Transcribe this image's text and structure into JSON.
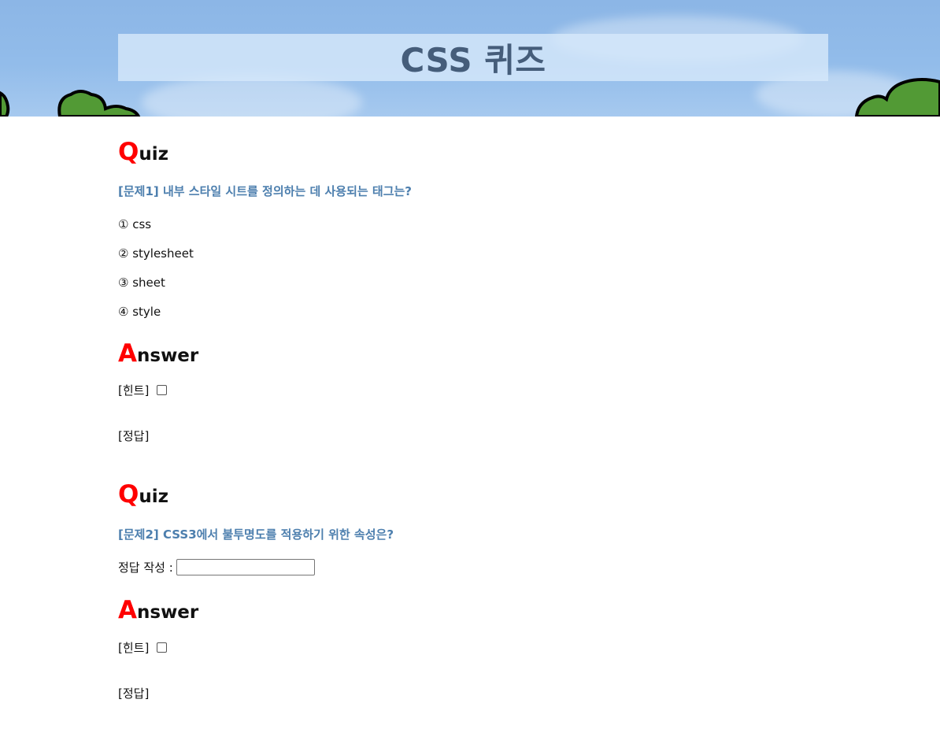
{
  "header": {
    "title": "CSS 퀴즈"
  },
  "quiz1": {
    "heading_cap": "Q",
    "heading_rest": "uiz",
    "question": "[문제1] 내부 스타일 시트를 정의하는 데 사용되는 태그는?",
    "options": [
      "① css",
      "② stylesheet",
      "③ sheet",
      "④ style"
    ],
    "answer_cap": "A",
    "answer_rest": "nswer",
    "hint_label": "[힌트]",
    "answer_label": "[정답]"
  },
  "quiz2": {
    "heading_cap": "Q",
    "heading_rest": "uiz",
    "question": "[문제2] CSS3에서 불투명도를 적용하기 위한 속성은?",
    "input_label": "정답 작성 :",
    "input_value": "",
    "answer_cap": "A",
    "answer_rest": "nswer",
    "hint_label": "[힌트]",
    "answer_label": "[정답]"
  },
  "colors": {
    "banner": "#8cb6e6",
    "title_text": "#455d7a",
    "accent_red": "#ff0000",
    "question_blue": "#4d7fae",
    "bush_green": "#529a35"
  }
}
